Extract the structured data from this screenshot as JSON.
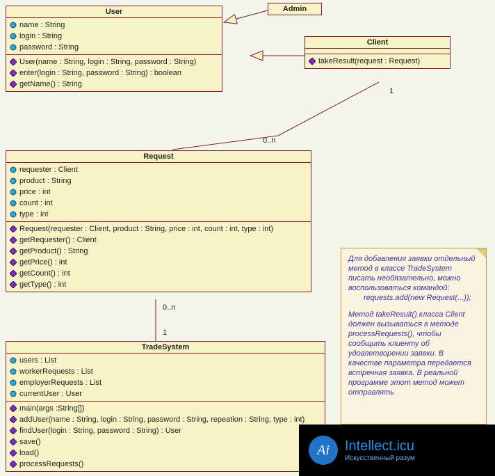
{
  "classes": {
    "user": {
      "name": "User",
      "attrs": [
        "name : String",
        "login : String",
        "password : String"
      ],
      "methods": [
        "User(name : String, login : String, password : String)",
        "enter(login : String, password : String) : boolean",
        "getName() : String"
      ]
    },
    "admin": {
      "name": "Admin",
      "attrs": [],
      "methods": []
    },
    "client": {
      "name": "Client",
      "attrs": [],
      "methods": [
        "takeResult(request : Request)"
      ]
    },
    "request": {
      "name": "Request",
      "attrs": [
        "requester : Client",
        "product : String",
        "price : int",
        "count : int",
        "type : int"
      ],
      "methods": [
        "Request(requester : Client, product : String, price : int, count : int, type : int)",
        "getRequester() : Client",
        "getProduct() : String",
        "getPrice() : int",
        "getCount() : int",
        "getType() : int"
      ]
    },
    "tradesystem": {
      "name": "TradeSystem",
      "attrs": [
        "users : List",
        "workerRequests : List",
        "employerRequests : List",
        "currentUser : User"
      ],
      "methods": [
        "main(args :String[])",
        "addUser(name : String, login : String, password : String, repeation : String, type : int)",
        "findUser(login : String, password : String) : User",
        "save()",
        "load()",
        "processRequests()"
      ]
    }
  },
  "note": {
    "p1a": "Для добавления заявки отдельный метод в классе TradeSystem писать необязательно, можно воспользоваться командой:",
    "p1b": "requests.add(new Request(...));",
    "p2": "Метод takeResult() класса Client должен вызываться в методе processRequests(), чтобы сообщить клиенту об удовлетворении заявки. В качестве параметра передается встречная заявка. В реальной программе этот метод может отправлять"
  },
  "multiplicity": {
    "client_one": "1",
    "request_many_top": "0..n",
    "request_many_bottom": "0..n",
    "tradesystem_one": "1"
  },
  "watermark": {
    "logo": "Ai",
    "site": "Intellect.icu",
    "tagline": "Искусственный разум"
  }
}
